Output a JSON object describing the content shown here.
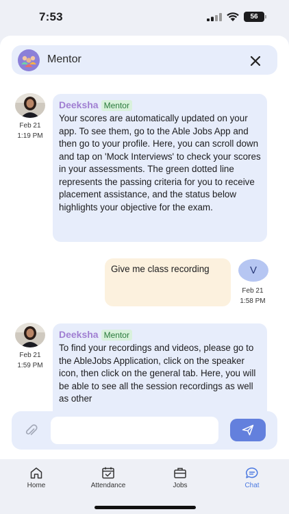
{
  "status_bar": {
    "time": "7:53",
    "battery": "56"
  },
  "header": {
    "title": "Mentor",
    "avatar_icon": "mentor-group-icon",
    "close_icon": "close-icon"
  },
  "messages": [
    {
      "direction": "incoming",
      "sender": "Deeksha",
      "role": "Mentor",
      "date": "Feb 21",
      "time": "1:19 PM",
      "text": "Your scores are automatically updated on your app. To see them, go to the Able Jobs App and then go to your profile. Here, you can scroll down and tap on 'Mock Interviews' to check your scores in your assessments. The green dotted line represents the passing criteria for you to receive placement assistance, and the status below highlights your objective for the exam."
    },
    {
      "direction": "outgoing",
      "avatar_letter": "V",
      "date": "Feb 21",
      "time": "1:58 PM",
      "text": "Give me class recording"
    },
    {
      "direction": "incoming",
      "sender": "Deeksha",
      "role": "Mentor",
      "date": "Feb 21",
      "time": "1:59 PM",
      "text": "To find your recordings and videos, please go to the AbleJobs Application, click on the speaker icon, then click on the general tab. Here, you will be able to see all the session recordings as well as other"
    }
  ],
  "composer": {
    "value": "",
    "placeholder": "",
    "attach_icon": "paperclip-icon",
    "send_icon": "send-icon"
  },
  "nav": [
    {
      "label": "Home",
      "icon": "home-icon",
      "active": false
    },
    {
      "label": "Attendance",
      "icon": "calendar-check-icon",
      "active": false
    },
    {
      "label": "Jobs",
      "icon": "briefcase-icon",
      "active": false
    },
    {
      "label": "Chat",
      "icon": "chat-bubble-icon",
      "active": true
    }
  ],
  "colors": {
    "accent": "#6380dd",
    "incoming_bubble": "#e7edfb",
    "outgoing_bubble": "#fcf1de",
    "sender_name": "#a07fd2",
    "badge_bg": "#d9f1dc",
    "nav_active": "#4a78e0"
  }
}
